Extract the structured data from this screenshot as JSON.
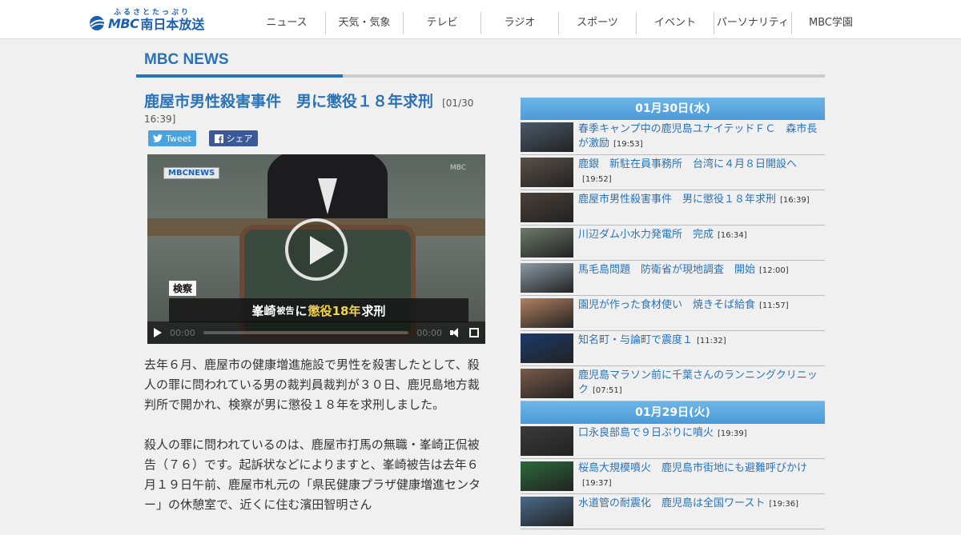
{
  "header": {
    "logo_ruby": "ふるさとたっぷり",
    "logo_brand": "MBC",
    "logo_name": "南日本放送",
    "nav": [
      "ニュース",
      "天気・気象",
      "テレビ",
      "ラジオ",
      "スポーツ",
      "イベント",
      "パーソナリティ",
      "MBC学園"
    ]
  },
  "section": {
    "title": "MBC NEWS"
  },
  "article": {
    "title": "鹿屋市男性殺害事件　男に懲役１８年求刑",
    "date": "[01/30 16:39]",
    "tweet_label": "Tweet",
    "share_label": "シェア",
    "video": {
      "badge": "MBCNEWS",
      "corner": "MBC",
      "caption_label": "検察",
      "caption_name": "峯崎",
      "caption_small": "被告",
      "caption_mid": "に",
      "caption_highlight": "懲役18年",
      "caption_end": "求刑",
      "time_current": "00:00",
      "time_total": "00:00"
    },
    "paragraphs": [
      "去年６月、鹿屋市の健康増進施設で男性を殺害したとして、殺人の罪に問われている男の裁判員裁判が３０日、鹿児島地方裁判所で開かれ、検察が男に懲役１８年を求刑しました。",
      "殺人の罪に問われているのは、鹿屋市打馬の無職・峯崎正侃被告（７６）です。起訴状などによりますと、峯崎被告は去年６月１９日午前、鹿屋市札元の「県民健康プラザ健康増進センター」の休憩室で、近くに住む濱田智明さん"
    ]
  },
  "sidebar": {
    "groups": [
      {
        "date": "01月30日(水)",
        "items": [
          {
            "title": "春季キャンプ中の鹿児島ユナイテッドＦＣ　森市長が激励",
            "time": "[19:53]",
            "thumb": "#4a5a6a"
          },
          {
            "title": "鹿銀　新駐在員事務所　台湾に４月８日開設へ",
            "time": "[19:52]",
            "thumb": "#5a5048"
          },
          {
            "title": "鹿屋市男性殺害事件　男に懲役１８年求刑",
            "time": "[16:39]",
            "thumb": "#4a4038"
          },
          {
            "title": "川辺ダム小水力発電所　完成",
            "time": "[16:34]",
            "thumb": "#6d7a6a"
          },
          {
            "title": "馬毛島問題　防衛省が現地調査　開始",
            "time": "[12:00]",
            "thumb": "#8a9aa4"
          },
          {
            "title": "園児が作った食材使い　焼きそば給食",
            "time": "[11:57]",
            "thumb": "#b08060"
          },
          {
            "title": "知名町・与論町で震度１",
            "time": "[11:32]",
            "thumb": "#1a3a6a"
          },
          {
            "title": "鹿児島マラソン前に千葉さんのランニングクリニック",
            "time": "[07:51]",
            "thumb": "#7a5a4a"
          }
        ]
      },
      {
        "date": "01月29日(火)",
        "items": [
          {
            "title": "口永良部島で９日ぶりに噴火",
            "time": "[19:39]",
            "thumb": "#3a3a3a"
          },
          {
            "title": "桜島大規模噴火　鹿児島市街地にも避難呼びかけ",
            "time": "[19:37]",
            "thumb": "#2a6a3a"
          },
          {
            "title": "水道管の耐震化　鹿児島は全国ワースト",
            "time": "[19:36]",
            "thumb": "#4a6a8a"
          }
        ]
      }
    ]
  }
}
